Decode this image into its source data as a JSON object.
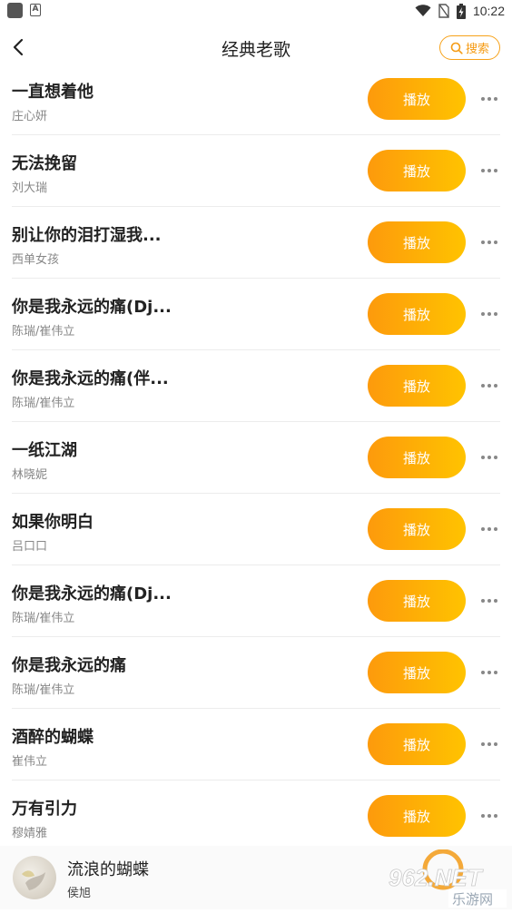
{
  "status_bar": {
    "app_icon_a": "A",
    "time": "10:22",
    "icons": [
      "wifi-icon",
      "no-sim-icon",
      "battery-charging-icon"
    ]
  },
  "header": {
    "back_icon": "chevron-left-icon",
    "title": "经典老歌",
    "search_label": "搜索",
    "search_icon": "search-icon"
  },
  "songs": [
    {
      "title": "一直想着他",
      "artist": "庄心妍"
    },
    {
      "title": "无法挽留",
      "artist": "刘大瑞"
    },
    {
      "title": "别让你的泪打湿我...",
      "artist": "西单女孩"
    },
    {
      "title": "你是我永远的痛(Dj...",
      "artist": "陈瑞/崔伟立"
    },
    {
      "title": "你是我永远的痛(伴...",
      "artist": "陈瑞/崔伟立"
    },
    {
      "title": "一纸江湖",
      "artist": "林晓妮"
    },
    {
      "title": "如果你明白",
      "artist": "吕口口"
    },
    {
      "title": "你是我永远的痛(Dj...",
      "artist": "陈瑞/崔伟立"
    },
    {
      "title": "你是我永远的痛",
      "artist": "陈瑞/崔伟立"
    },
    {
      "title": "酒醉的蝴蝶",
      "artist": "崔伟立"
    },
    {
      "title": "万有引力",
      "artist": "穆婧雅"
    }
  ],
  "play_label": "播放",
  "more_icon": "more-horizontal-icon",
  "now_playing": {
    "title": "流浪的蝴蝶",
    "artist": "侯旭"
  },
  "watermark": {
    "brand": "962.NET",
    "subtitle": "乐游网"
  },
  "colors": {
    "accent": "#fd9a0c",
    "accent_end": "#ffc300"
  }
}
